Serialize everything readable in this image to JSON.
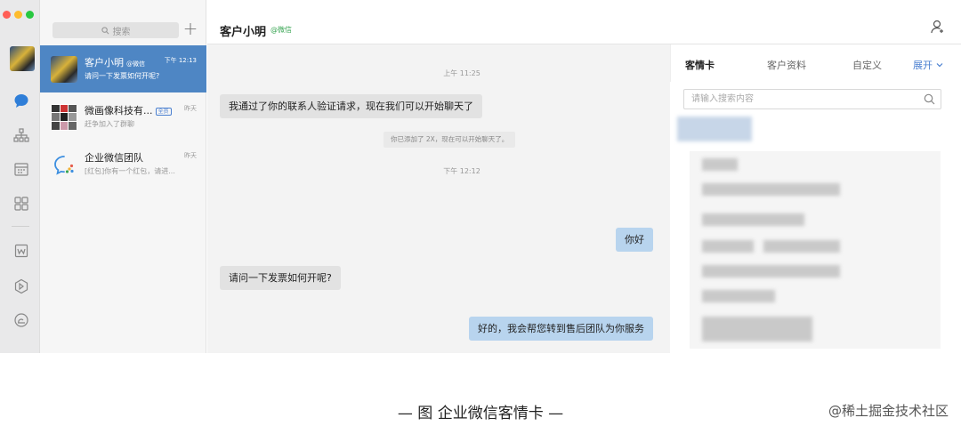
{
  "colors": {
    "accent": "#4e86c4",
    "sent_bubble": "#b8d4ee",
    "received_bubble": "#e2e2e2",
    "wechat_tag": "#3aa654",
    "traffic_red": "#ff5f57",
    "traffic_yellow": "#febc2e",
    "traffic_green": "#28c840"
  },
  "rail": {
    "icons": [
      "chat-icon",
      "org-icon",
      "calendar-icon",
      "apps-icon",
      "doc-icon",
      "hexagon-icon",
      "cloud-icon"
    ]
  },
  "list": {
    "search_placeholder": "搜索",
    "add_label": "+",
    "items": [
      {
        "name": "客户小明",
        "tag": "@微信",
        "time": "下午 12:13",
        "preview": "请问一下发票如何开呢?"
      },
      {
        "name": "微画像科技有...",
        "badge": "全员",
        "time": "昨天",
        "preview": "赶争加入了群聊"
      },
      {
        "name": "企业微信团队",
        "time": "昨天",
        "preview": "[红包]你有一个红包，请进..."
      }
    ]
  },
  "chat": {
    "title": "客户小明",
    "title_tag": "@微信",
    "time_1": "上午 11:25",
    "time_2": "下午 12:12",
    "system_note": "你已添加了 2X，现在可以开始聊天了。",
    "messages": [
      {
        "text": "我通过了你的联系人验证请求，现在我们可以开始聊天了"
      },
      {
        "text": "你好"
      },
      {
        "text": "请问一下发票如何开呢?"
      },
      {
        "text": "好的，我会帮您转到售后团队为你服务"
      }
    ]
  },
  "panel": {
    "tabs": [
      "客情卡",
      "客户资料",
      "自定义"
    ],
    "expand_label": "展开",
    "search_placeholder": "请输入搜索内容"
  },
  "caption": "— 图  企业微信客情卡 —",
  "watermark": "@稀土掘金技术社区"
}
